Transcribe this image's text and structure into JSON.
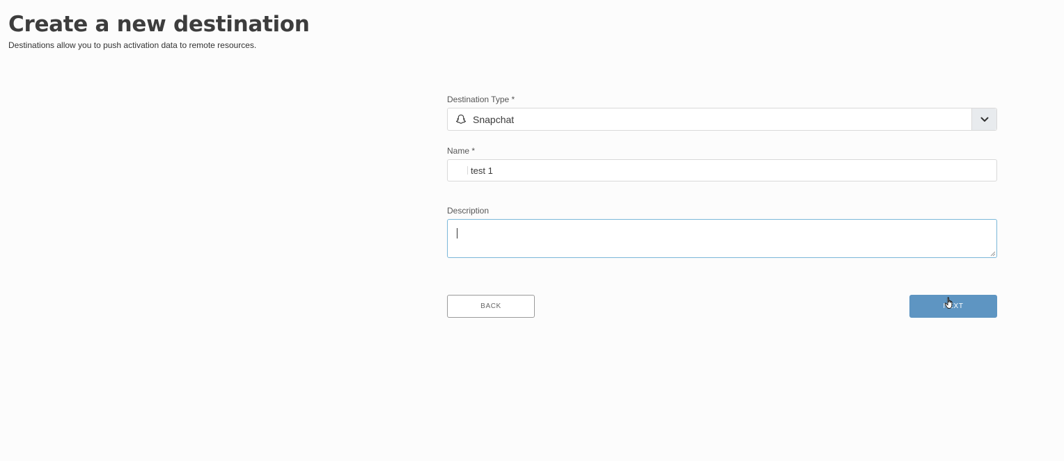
{
  "header": {
    "title": "Create a new destination",
    "subtitle": "Destinations allow you to push activation data to remote resources."
  },
  "form": {
    "destination_type": {
      "label": "Destination Type *",
      "value": "Snapchat",
      "icon": "snapchat-ghost-icon"
    },
    "name": {
      "label": "Name *",
      "value": "test 1"
    },
    "description": {
      "label": "Description",
      "value": ""
    }
  },
  "buttons": {
    "back_label": "BACK",
    "next_label": "NEXT"
  },
  "colors": {
    "primary": "#5e95c2",
    "focus_border": "#7ab7d9"
  }
}
